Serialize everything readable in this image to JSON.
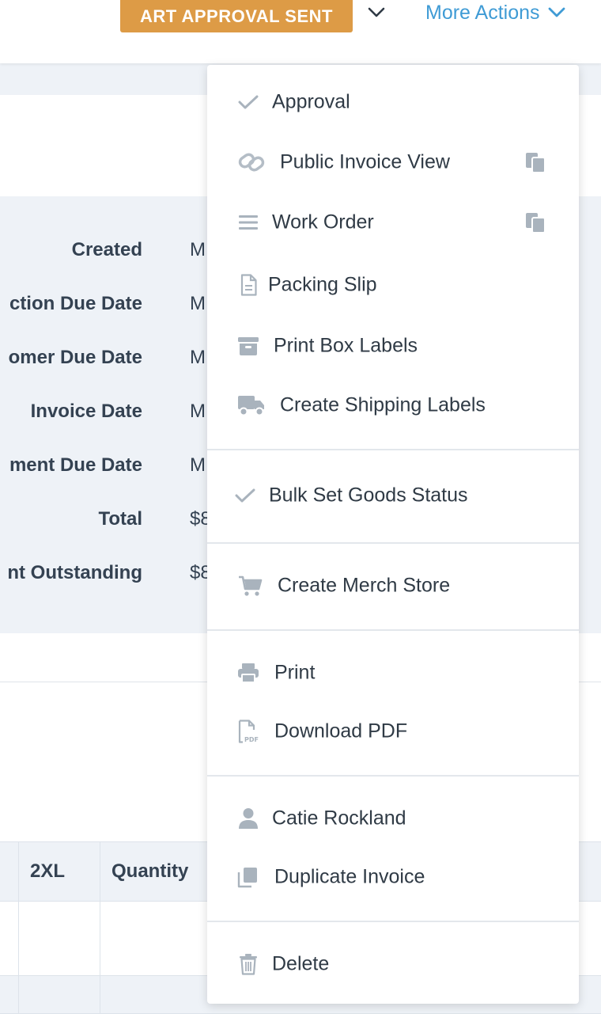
{
  "header": {
    "status_label": "ART APPROVAL SENT",
    "more_actions_label": "More Actions"
  },
  "summary": {
    "rows": [
      {
        "label": "Created",
        "value": "M"
      },
      {
        "label": "ction Due Date",
        "value": "M"
      },
      {
        "label": "omer Due Date",
        "value": "M"
      },
      {
        "label": "Invoice Date",
        "value": "M"
      },
      {
        "label": "ment Due Date",
        "value": "M"
      },
      {
        "label": "Total",
        "value": "$8"
      },
      {
        "label": "nt Outstanding",
        "value": "$8"
      }
    ]
  },
  "table": {
    "headers": [
      "2XL",
      "Quantity"
    ]
  },
  "menu": {
    "approval": "Approval",
    "public_invoice_view": "Public Invoice View",
    "work_order": "Work Order",
    "packing_slip": "Packing Slip",
    "print_box_labels": "Print Box Labels",
    "create_shipping_labels": "Create Shipping Labels",
    "bulk_set_goods_status": "Bulk Set Goods Status",
    "create_merch_store": "Create Merch Store",
    "print": "Print",
    "download_pdf": "Download PDF",
    "customer_name": "Catie Rockland",
    "duplicate_invoice": "Duplicate Invoice",
    "delete": "Delete"
  },
  "icons": {
    "approval": "check-icon",
    "public_invoice_view": "link-icon",
    "work_order": "list-icon",
    "packing_slip": "document-icon",
    "print_box_labels": "archive-box-icon",
    "create_shipping_labels": "truck-icon",
    "bulk_set_goods_status": "check-icon",
    "create_merch_store": "cart-icon",
    "print": "printer-icon",
    "download_pdf": "pdf-file-icon",
    "customer": "user-icon",
    "duplicate_invoice": "duplicate-icon",
    "delete": "trash-icon",
    "copy": "clipboard-copy-icon"
  },
  "colors": {
    "status_badge": "#dd9b46",
    "link_blue": "#3f9bd5",
    "icon_gray": "#a9b3bd"
  }
}
